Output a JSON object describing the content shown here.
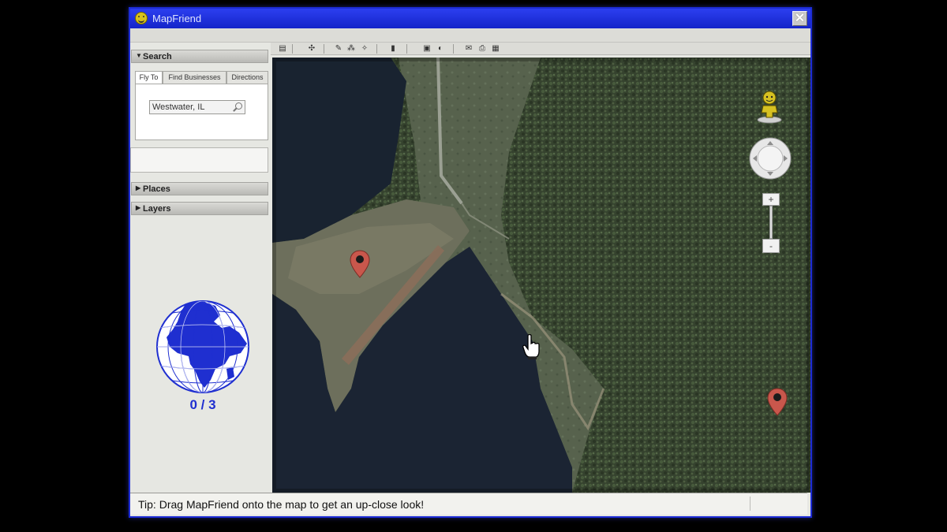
{
  "window": {
    "title": "MapFriend"
  },
  "search": {
    "header": "Search",
    "tabs": [
      {
        "label": "Fly To",
        "active": true
      },
      {
        "label": "Find Businesses",
        "active": false
      },
      {
        "label": "Directions",
        "active": false
      }
    ],
    "location_value": "Westwater, IL"
  },
  "places": {
    "header": "Places"
  },
  "layers": {
    "header": "Layers"
  },
  "progress": {
    "counter": "0 / 3",
    "found": 0,
    "total": 3
  },
  "map": {
    "markers": [
      {
        "name": "marker-1"
      },
      {
        "name": "marker-2"
      }
    ],
    "controls": {
      "zoom_in": "+",
      "zoom_out": "-"
    }
  },
  "status": {
    "tip": "Tip: Drag MapFriend onto the map to get an up-close look!"
  },
  "colors": {
    "titlebar": "#1f2fd0",
    "accent": "#1f2fd0",
    "marker": "#c9574c"
  }
}
